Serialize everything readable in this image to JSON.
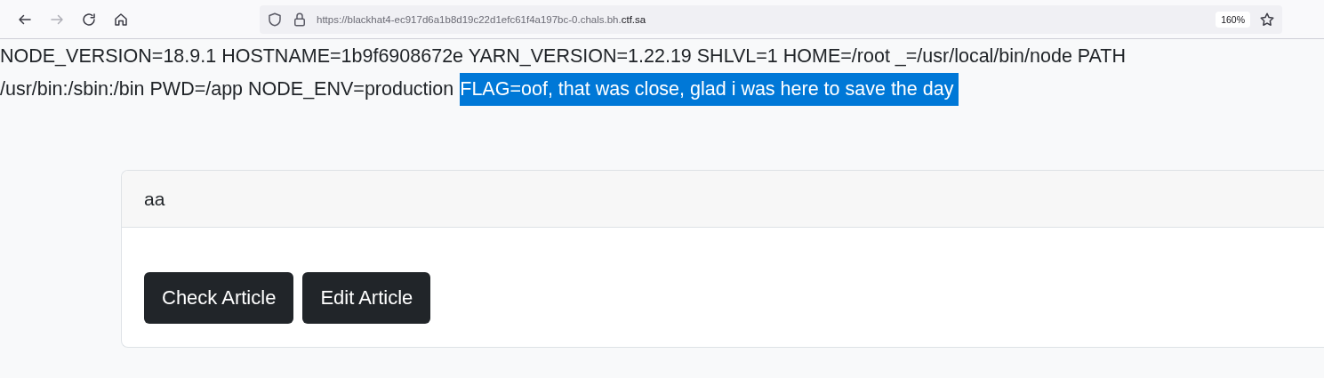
{
  "toolbar": {
    "url_prefix": "https://blackhat4-ec917d6a1b8d19c22d1efc61f4a197bc-0.chals.bh.",
    "url_domain": "ctf.sa",
    "zoom": "160%",
    "forward_disabled": true
  },
  "env": {
    "lines": [
      "NODE_VERSION=18.9.1 HOSTNAME=1b9f6908672e YARN_VERSION=1.22.19 SHLVL=1 HOME=/root _=/usr/local/bin/node PATH",
      "/usr/bin:/sbin:/bin PWD=/app NODE_ENV=production"
    ],
    "flag": {
      "text": "FLAG=oof, that was close, glad i was here to save the day",
      "selected": true
    }
  },
  "card": {
    "title": "aa",
    "buttons": [
      "Check Article",
      "Edit Article"
    ]
  }
}
